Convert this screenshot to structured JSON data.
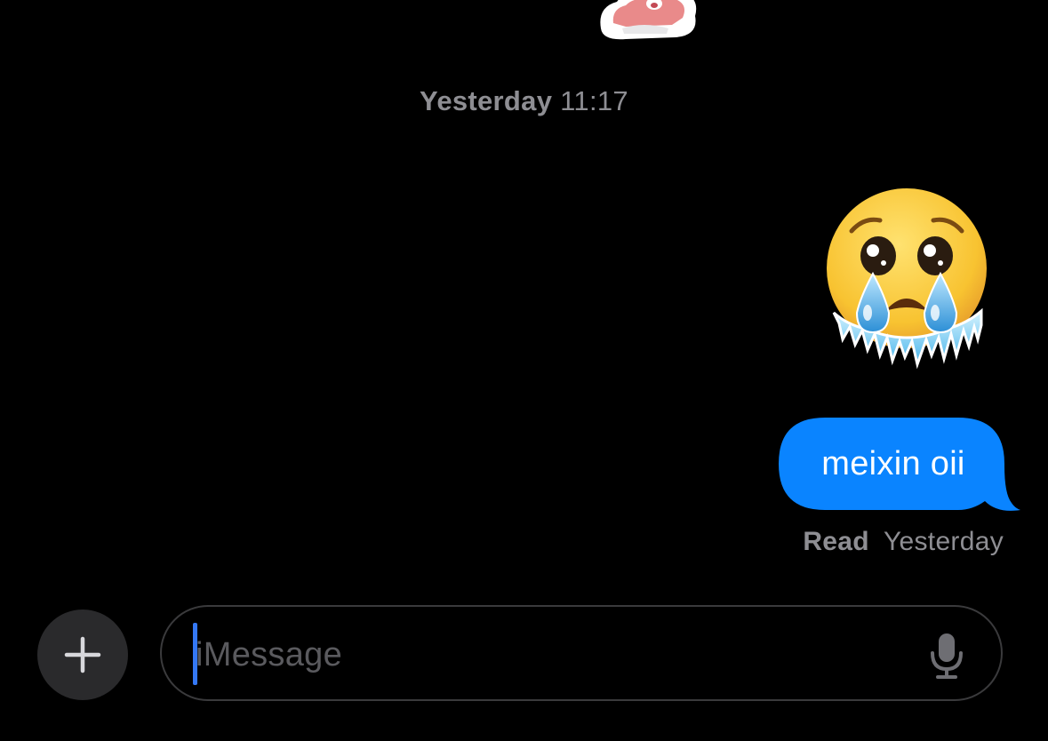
{
  "conversation": {
    "timestamp": {
      "day": "Yesterday",
      "time": "11:17"
    },
    "messages": [
      {
        "type": "emoji",
        "icon": "freezing-crying-face-emoji",
        "direction": "outgoing"
      },
      {
        "type": "text",
        "text": "meixin oii",
        "direction": "outgoing",
        "bubble_color": "#0a84ff"
      }
    ],
    "receipt": {
      "status": "Read",
      "when": "Yesterday"
    }
  },
  "composer": {
    "plus_icon": "plus-icon",
    "placeholder": "iMessage",
    "mic_icon": "microphone-icon",
    "cursor_color": "#3478f6"
  },
  "colors": {
    "background": "#000000",
    "outgoing_bubble": "#0a84ff",
    "secondary_text": "#8e8e93"
  }
}
